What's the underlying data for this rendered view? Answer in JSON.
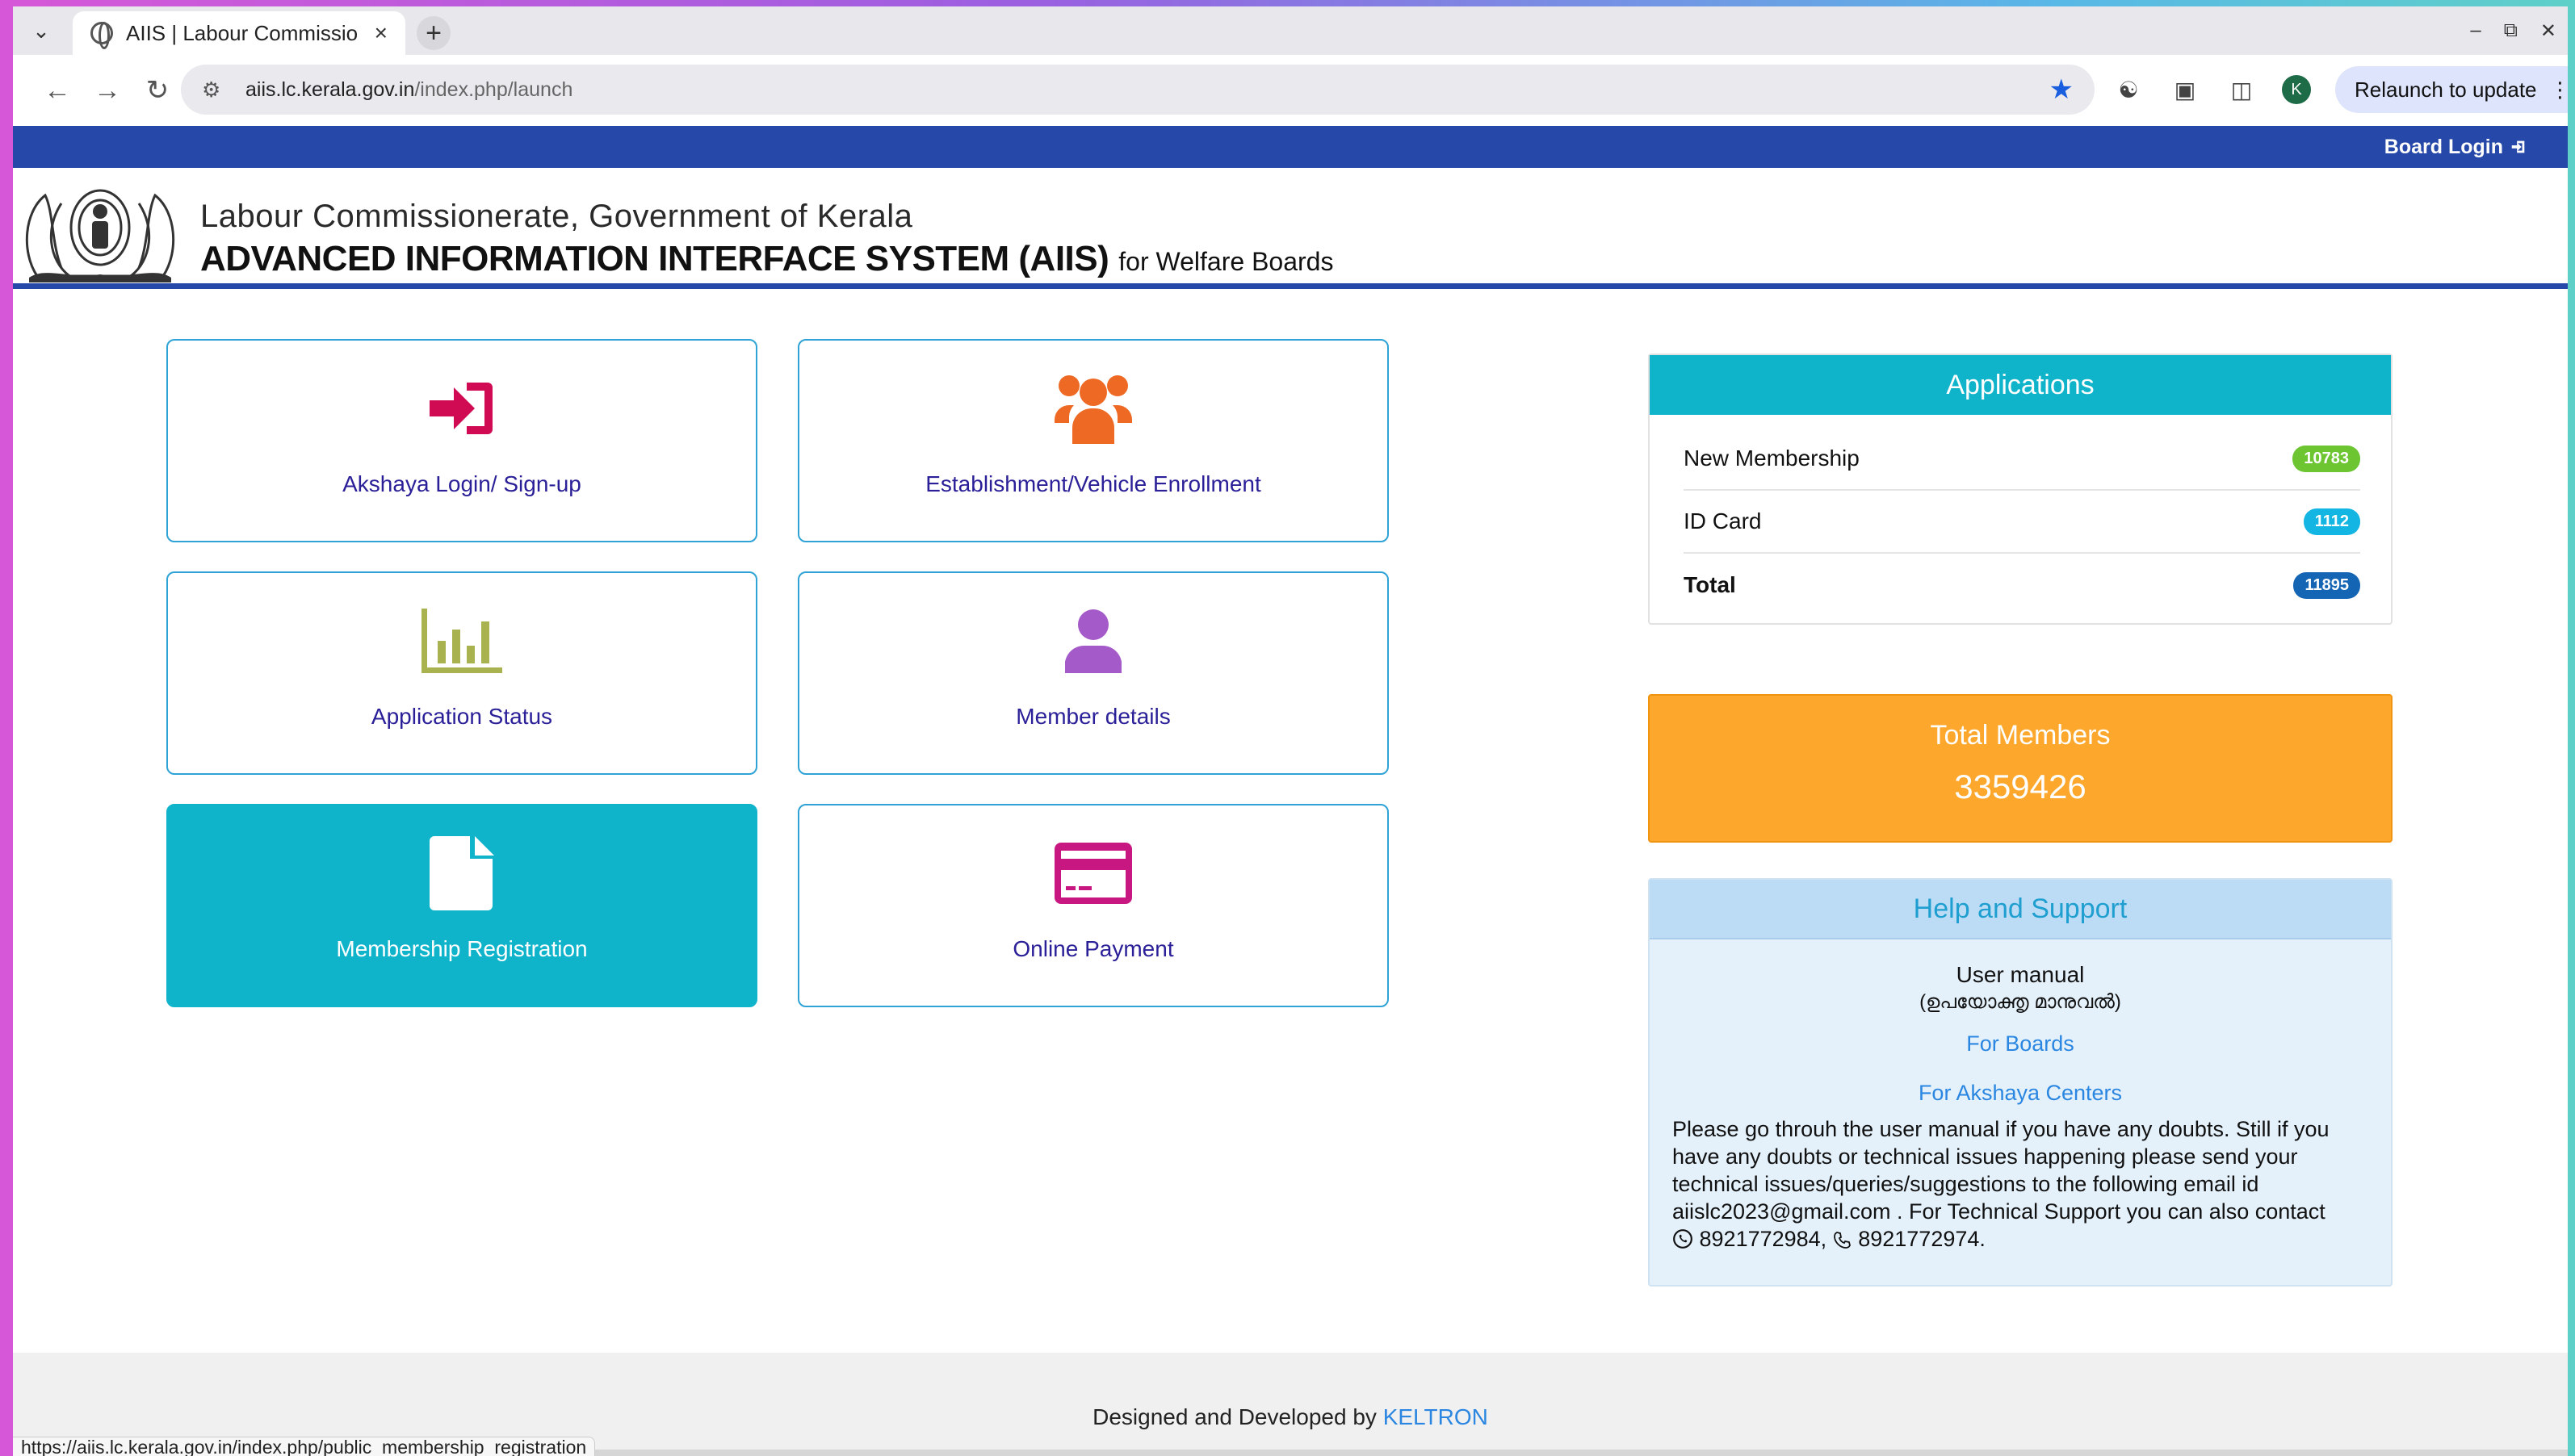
{
  "browser": {
    "tab_title": "AIIS | Labour Commissio",
    "tab_close": "×",
    "new_tab": "+",
    "url_host": "aiis.lc.kerala.gov.in",
    "url_path": "/index.php/launch",
    "profile_initial": "K",
    "relaunch_label": "Relaunch to update",
    "status_url": "https://aiis.lc.kerala.gov.in/index.php/public_membership_registration"
  },
  "topbar": {
    "board_login": "Board Login"
  },
  "header": {
    "line1": "Labour Commissionerate,  Government of Kerala",
    "line2": "ADVANCED INFORMATION INTERFACE SYSTEM (AIIS)",
    "line2_suffix": "for Welfare Boards"
  },
  "tiles": [
    {
      "label": "Akshaya Login/ Sign-up",
      "icon": "sign-in-icon",
      "color": "#d10a54"
    },
    {
      "label": "Establishment/Vehicle Enrollment",
      "icon": "users-icon",
      "color": "#ee6a24"
    },
    {
      "label": "Application Status",
      "icon": "bar-chart-icon",
      "color": "#a8b24f"
    },
    {
      "label": "Member details",
      "icon": "user-icon",
      "color": "#a45ac8"
    },
    {
      "label": "Membership Registration",
      "icon": "file-icon",
      "color": "#ffffff"
    },
    {
      "label": "Online Payment",
      "icon": "credit-card-icon",
      "color": "#c81780"
    }
  ],
  "applications": {
    "title": "Applications",
    "rows": [
      {
        "label": "New Membership",
        "count": "10783",
        "badge_color": "#6cc531"
      },
      {
        "label": "ID Card",
        "count": "1112",
        "badge_color": "#13b5e3"
      },
      {
        "label": "Total",
        "count": "11895",
        "badge_color": "#1565b5"
      }
    ]
  },
  "members": {
    "title": "Total Members",
    "value": "3359426"
  },
  "help": {
    "title": "Help and Support",
    "user_manual": "User manual",
    "user_manual_ml": "(ഉപയോക്തൃ മാനുവൽ)",
    "for_boards": "For Boards",
    "for_akshaya": "For Akshaya Centers",
    "text": "Please go throuh the user manual if you have any doubts. Still if you have any doubts or technical issues happening please send your technical issues/queries/suggestions to the following email id aiislc2023@gmail.com . For Technical Support you can also contact",
    "whatsapp": "8921772984,",
    "phone": "8921772974."
  },
  "footer": {
    "text": "Designed and Developed by",
    "link": "KELTRON"
  },
  "colors": {
    "brand_blue": "#2648a8",
    "accent_cyan": "#0fb4cb",
    "members_orange": "#fda82c",
    "link": "#2a86e0",
    "tile_label": "#2b2098"
  }
}
